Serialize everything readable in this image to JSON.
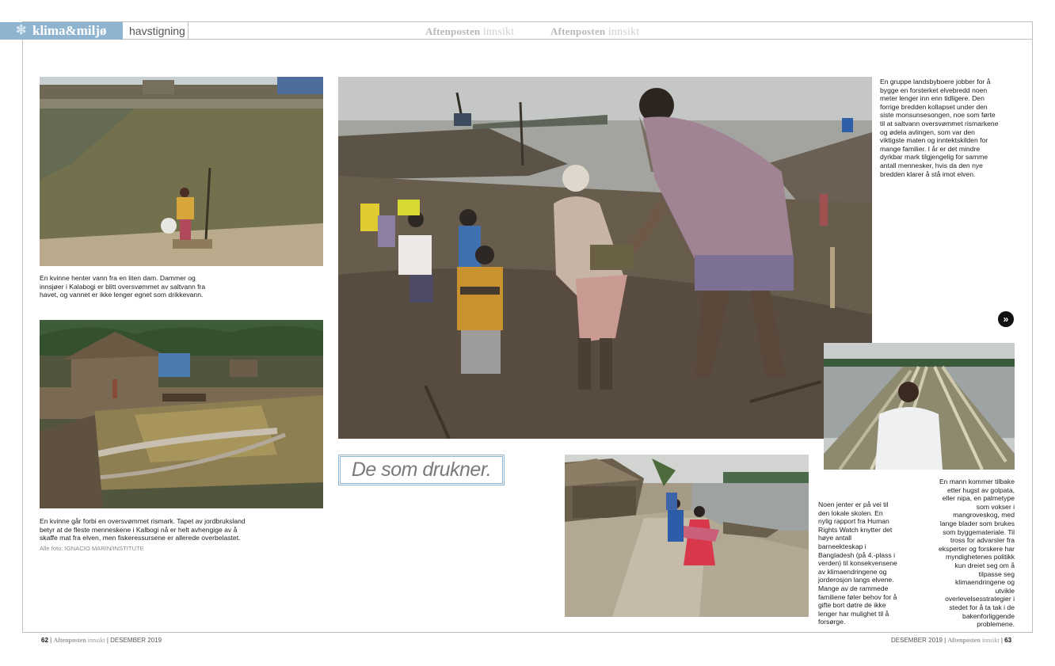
{
  "header": {
    "section": "klima&miljø",
    "subsection": "havstigning",
    "mastheads": [
      {
        "brand": "Aftenposten",
        "product": "innsikt"
      },
      {
        "brand": "Aftenposten",
        "product": "innsikt"
      }
    ]
  },
  "captions": {
    "pond": "En kvinne henter vann fra en liten dam. Dammer og innsjøer i Kalabogi er blitt oversvømmet av saltvann fra havet, og vannet er ikke lenger egnet som drikkevann.",
    "ricefield": "En kvinne går forbi en oversvømmet rismark. Tapet av jordbruksland betyr at de fleste menneskene i Kalbogi nå er helt avhengige av å skaffe mat fra elven, men fiskeressursene er allerede overbelastet.",
    "credit": "Alle foto: IGNACIO MARIN/INSTITUTE",
    "riverbank": "En gruppe landsbyboere jobber for å bygge en forsterket elvebredd noen meter lenger inn enn tidligere. Den forrige bredden kollapset under den siste monsunsesongen, noe som førte til at saltvann oversvømmet rismarkene og ødela avlingen, som var den viktigste maten og inntektskilden for mange familier. I år er det mindre dyrkbar mark tilgjengelig for samme antall mennesker, hvis da den nye bredden klarer å stå imot elven.",
    "girls": "Noen jenter er på vei til den lokale skolen. En nylig rapport fra Human Rights Watch knytter det høye antall barneekteskap i Bangladesh (på 4.-plass i verden) til konsekvensene av klimaendringene og jorderosjon langs elvene. Mange av de rammede familiene føler behov for å gifte bort døtre de ikke lenger har mulighet til å forsørge.",
    "bamboo": "En mann kommer tilbake etter hugst av golpata, eller nipa, en palmetype som vokser i mangroveskog, med lange blader som brukes som byggemateriale. Til tross for advarsler fra eksperter og forskere har myndighetenes politikk kun dreiet seg om å tilpasse seg klimaendringene og utvikle overlevelsesstrategier i stedet for å ta tak i de bakenforliggende problemene."
  },
  "title": "De som drukner.",
  "next_glyph": "»",
  "footer": {
    "left_page": "62",
    "left_date": "DESEMBER 2019",
    "right_date": "DESEMBER 2019",
    "right_page": "63",
    "brand": "Aftenposten",
    "product": "innsikt",
    "separator": "|"
  },
  "colors": {
    "accent": "#8fb4cf",
    "frame": "#bfbfbf",
    "text": "#1a1a1a"
  }
}
